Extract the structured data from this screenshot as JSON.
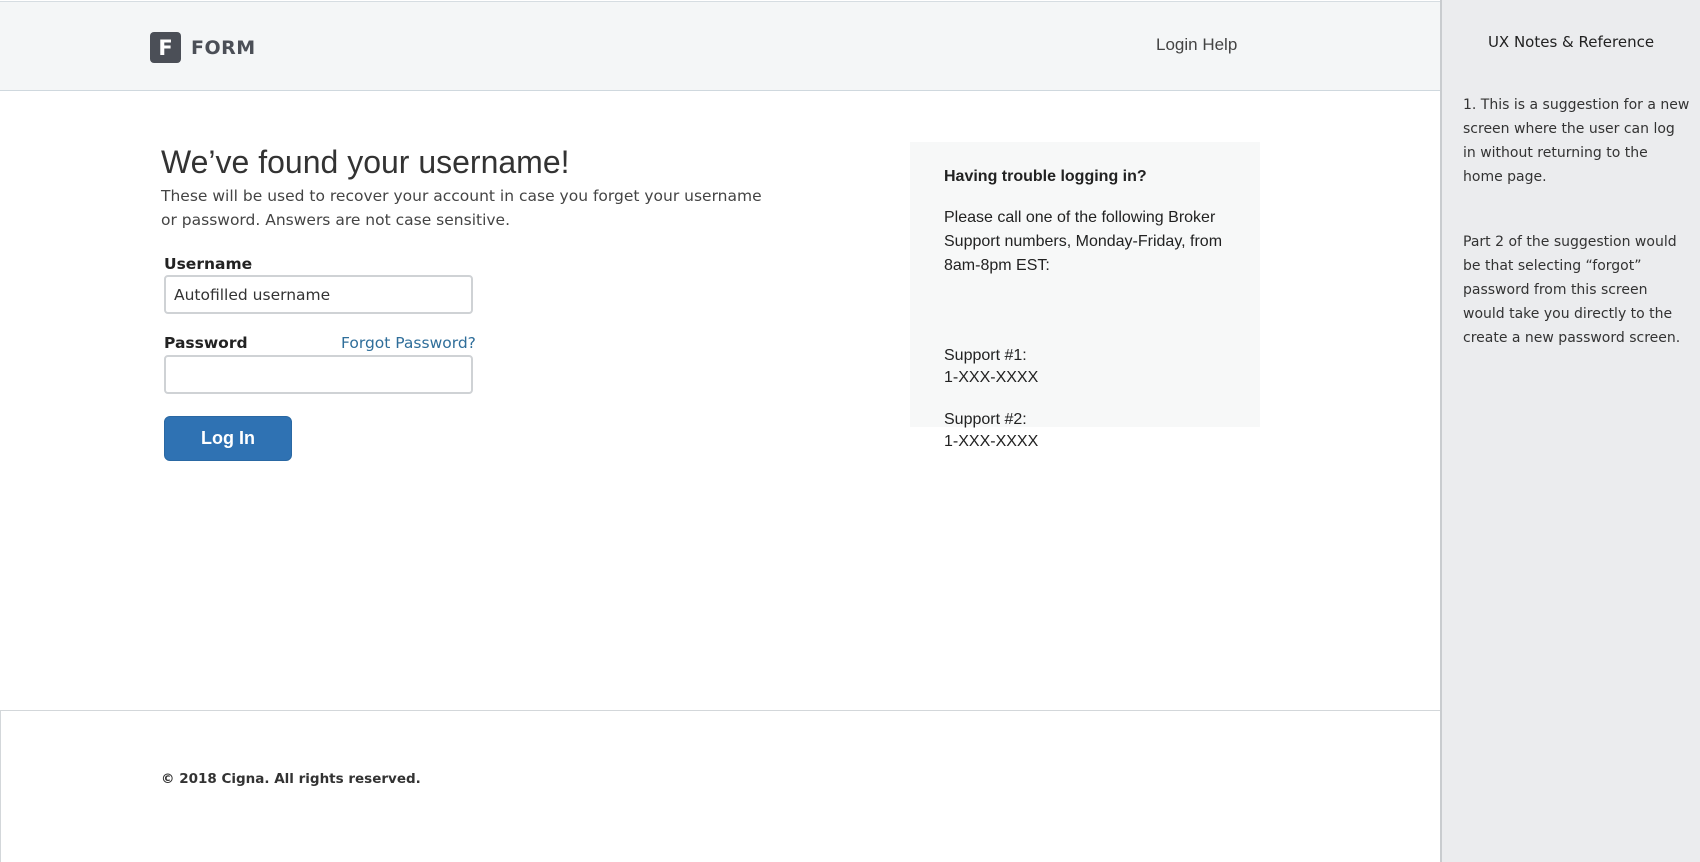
{
  "header": {
    "logo_letter": "F",
    "logo_text": "FORM",
    "login_help": "Login Help"
  },
  "main": {
    "title": "We’ve found your username!",
    "subtitle": "These will be used to recover your account in case you forget your username or password. Answers are not case sensitive.",
    "form": {
      "username_label": "Username",
      "username_value": "Autofilled username",
      "password_label": "Password",
      "password_value": "",
      "forgot_link": "Forgot Password?",
      "login_button": "Log In"
    }
  },
  "help": {
    "title": "Having trouble logging in?",
    "body": "Please call one of the following Broker Support numbers, Monday-Friday, from 8am-8pm EST:",
    "support": [
      {
        "label": "Support #1:",
        "number": "1-XXX-XXXX"
      },
      {
        "label": "Support #2:",
        "number": "1-XXX-XXXX"
      }
    ]
  },
  "footer": {
    "copyright": "© 2018 Cigna. All rights reserved."
  },
  "notes": {
    "title": "UX Notes & Reference",
    "items": [
      "1. This is a suggestion for a new screen where the user can log in without returning to the home page.",
      "Part 2 of the suggestion would be that selecting “forgot” password from this screen would take you directly to the create a new password screen."
    ]
  },
  "colors": {
    "primary_button": "#2f72b3",
    "link": "#2f6e9a",
    "header_bg": "#f4f6f7",
    "notes_bg": "#ebecee"
  }
}
